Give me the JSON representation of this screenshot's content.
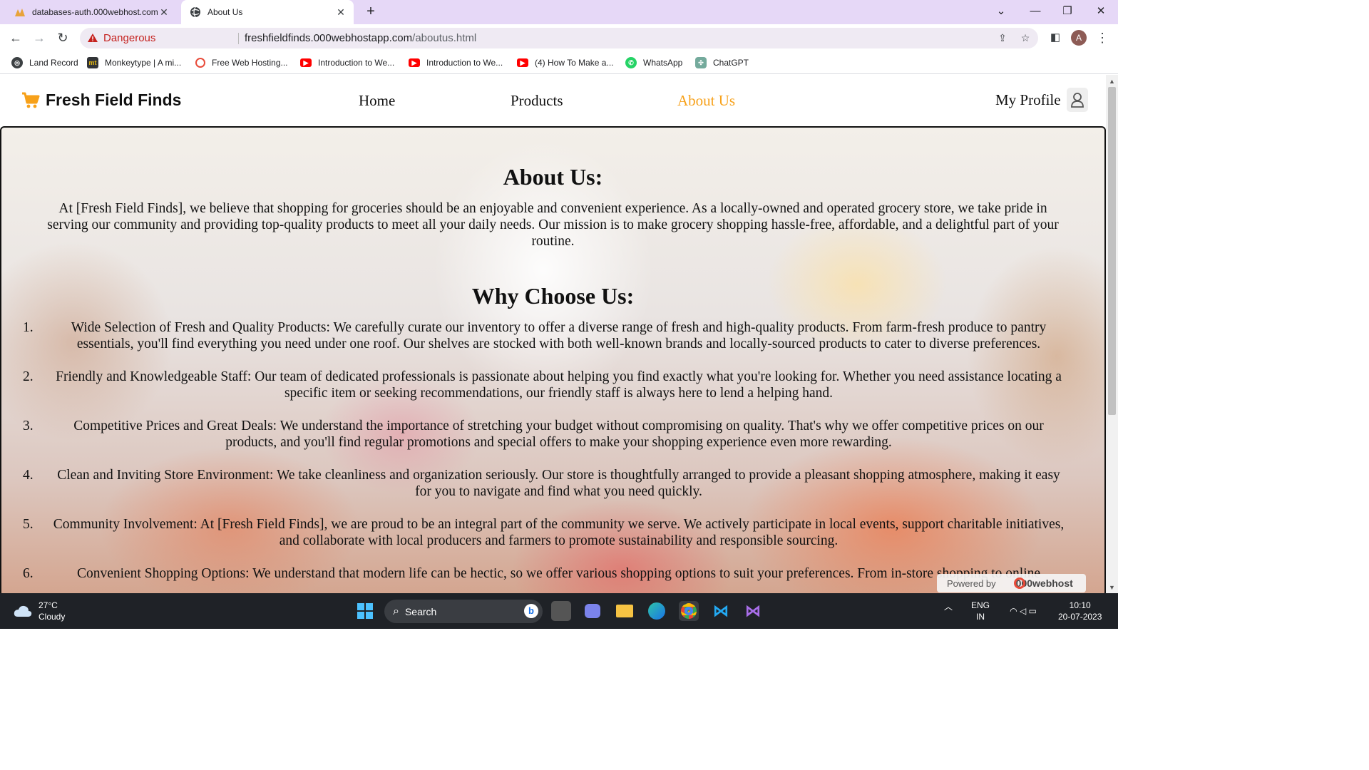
{
  "browser": {
    "tabs": [
      {
        "title": "databases-auth.000webhost.com",
        "active": false
      },
      {
        "title": "About Us",
        "active": true
      }
    ],
    "security_label": "Dangerous",
    "url_host": "freshfieldfinds.000webhostapp.com",
    "url_path": "/aboutus.html",
    "profile_initial": "A",
    "bookmarks": [
      {
        "label": "Land Record",
        "icon": "globe-icon"
      },
      {
        "label": "Monkeytype | A mi...",
        "icon": "monkeytype-icon"
      },
      {
        "label": "Free Web Hosting...",
        "icon": "000webhost-icon"
      },
      {
        "label": "Introduction to We...",
        "icon": "youtube-icon"
      },
      {
        "label": "Introduction to We...",
        "icon": "youtube-icon"
      },
      {
        "label": "(4) How To Make a...",
        "icon": "youtube-icon"
      },
      {
        "label": "WhatsApp",
        "icon": "whatsapp-icon"
      },
      {
        "label": "ChatGPT",
        "icon": "chatgpt-icon"
      }
    ]
  },
  "site": {
    "brand": "Fresh Field Finds",
    "nav": {
      "home": "Home",
      "products": "Products",
      "about": "About Us",
      "profile": "My Profile"
    },
    "accent_color": "#f7a11a",
    "about_heading": "About Us:",
    "about_text": "At [Fresh Field Finds], we believe that shopping for groceries should be an enjoyable and convenient experience. As a locally-owned and operated grocery store, we take pride in serving our community and providing top-quality products to meet all your daily needs. Our mission is to make grocery shopping hassle-free, affordable, and a delightful part of your routine.",
    "why_heading": "Why Choose Us:",
    "reasons": [
      {
        "num": "1.",
        "text": "Wide Selection of Fresh and Quality Products: We carefully curate our inventory to offer a diverse range of fresh and high-quality products. From farm-fresh produce to pantry essentials, you'll find everything you need under one roof. Our shelves are stocked with both well-known brands and locally-sourced products to cater to diverse preferences."
      },
      {
        "num": "2.",
        "text": "Friendly and Knowledgeable Staff: Our team of dedicated professionals is passionate about helping you find exactly what you're looking for. Whether you need assistance locating a specific item or seeking recommendations, our friendly staff is always here to lend a helping hand."
      },
      {
        "num": "3.",
        "text": "Competitive Prices and Great Deals: We understand the importance of stretching your budget without compromising on quality. That's why we offer competitive prices on our products, and you'll find regular promotions and special offers to make your shopping experience even more rewarding."
      },
      {
        "num": "4.",
        "text": "Clean and Inviting Store Environment: We take cleanliness and organization seriously. Our store is thoughtfully arranged to provide a pleasant shopping atmosphere, making it easy for you to navigate and find what you need quickly."
      },
      {
        "num": "5.",
        "text": "Community Involvement: At [Fresh Field Finds], we are proud to be an integral part of the community we serve. We actively participate in local events, support charitable initiatives, and collaborate with local producers and farmers to promote sustainability and responsible sourcing."
      },
      {
        "num": "6.",
        "text": "Convenient Shopping Options: We understand that modern life can be hectic, so we offer various shopping options to suit your preferences. From in-store shopping to online"
      }
    ],
    "badge_prefix": "Powered by",
    "badge_brand": "000webhost"
  },
  "taskbar": {
    "weather_temp": "27°C",
    "weather_desc": "Cloudy",
    "search_label": "Search",
    "lang_top": "ENG",
    "lang_bottom": "IN",
    "time": "10:10",
    "date": "20-07-2023"
  }
}
